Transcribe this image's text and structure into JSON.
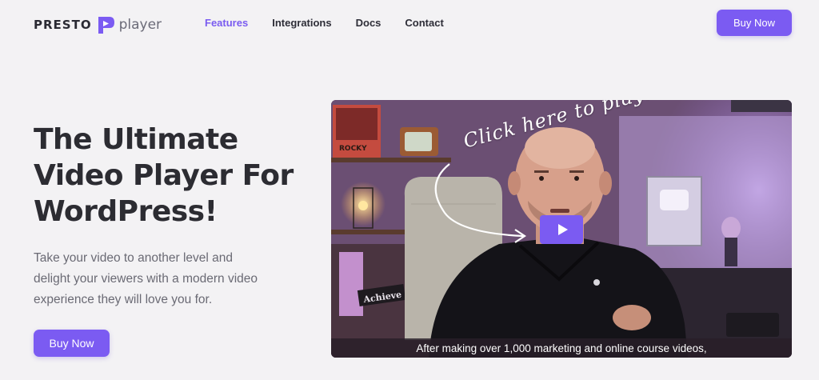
{
  "brand": {
    "name_left": "PRESTO",
    "name_right": "player",
    "accent": "#7b5bf2"
  },
  "nav": {
    "items": [
      {
        "label": "Features",
        "active": true
      },
      {
        "label": "Integrations",
        "active": false
      },
      {
        "label": "Docs",
        "active": false
      },
      {
        "label": "Contact",
        "active": false
      }
    ]
  },
  "header": {
    "buy_label": "Buy Now"
  },
  "hero": {
    "title_line1": "The Ultimate",
    "title_line2": "Video Player For",
    "title_line3": "WordPress!",
    "subtitle_line1": "Take your video to another level and",
    "subtitle_line2": "delight your viewers with a modern video",
    "subtitle_line3": "experience they will love you for.",
    "buy_label": "Buy Now"
  },
  "video": {
    "overlay_text": "Click here to play!",
    "poster_sign": "ROCKY",
    "desk_sign": "Achieve",
    "caption": "After making over 1,000 marketing and online course videos,",
    "play_icon": "play-icon"
  }
}
